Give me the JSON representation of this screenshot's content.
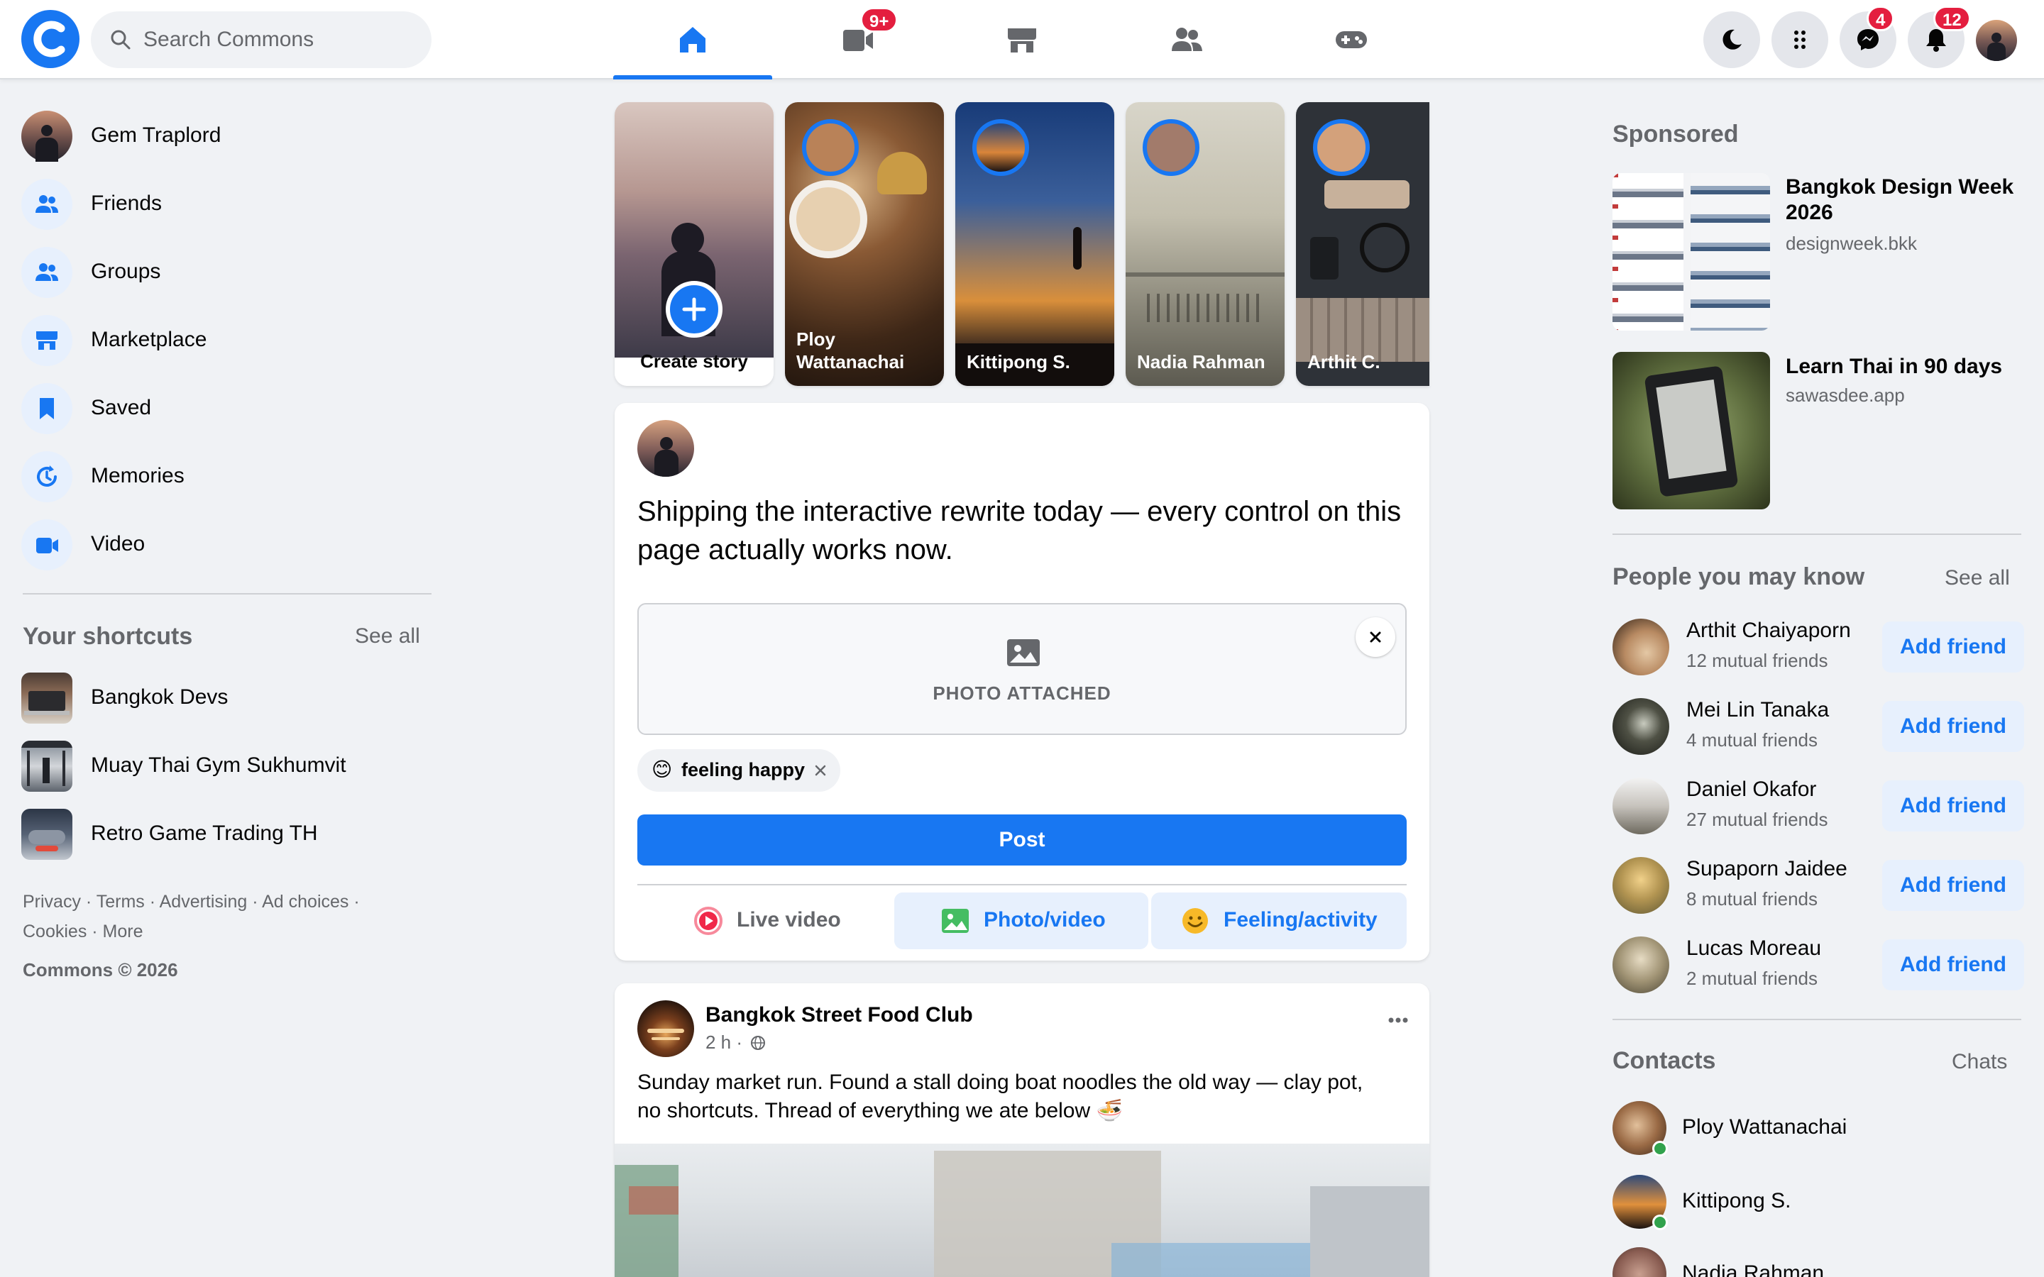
{
  "brand": {
    "logo_letter": "C",
    "accent": "#1877f2",
    "badge_color": "#e41e3f",
    "online_color": "#31a24c"
  },
  "search": {
    "placeholder": "Search Commons"
  },
  "nav": {
    "tabs": [
      {
        "name": "home-icon",
        "active": true
      },
      {
        "name": "video-icon",
        "badge": "9+"
      },
      {
        "name": "marketplace-icon"
      },
      {
        "name": "groups-icon"
      },
      {
        "name": "gaming-icon"
      }
    ]
  },
  "header_actions": {
    "dark_mode": "moon-icon",
    "menu": "grid-menu-icon",
    "messages_badge": "4",
    "notifications_badge": "12"
  },
  "sidebar": {
    "items": [
      {
        "label": "Gem Traplord",
        "icon": "profile-avatar"
      },
      {
        "label": "Friends",
        "icon": "friends-icon"
      },
      {
        "label": "Groups",
        "icon": "groups-icon"
      },
      {
        "label": "Marketplace",
        "icon": "marketplace-icon"
      },
      {
        "label": "Saved",
        "icon": "bookmark-icon"
      },
      {
        "label": "Memories",
        "icon": "memories-icon"
      },
      {
        "label": "Video",
        "icon": "video-icon"
      }
    ],
    "shortcuts_title": "Your shortcuts",
    "shortcuts_see_all": "See all",
    "shortcuts": [
      {
        "label": "Bangkok Devs"
      },
      {
        "label": "Muay Thai Gym Sukhumvit"
      },
      {
        "label": "Retro Game Trading TH"
      }
    ],
    "footer": {
      "line1": "Privacy · Terms · Advertising · Ad choices ·",
      "line2": "Cookies · More",
      "copyright": "Commons © 2026"
    }
  },
  "stories": {
    "create_label": "Create story",
    "items": [
      {
        "name": "Ploy Wattanachai"
      },
      {
        "name": "Kittipong S."
      },
      {
        "name": "Nadia Rahman"
      },
      {
        "name": "Arthit C."
      }
    ]
  },
  "composer": {
    "text": "Shipping the interactive rewrite today — every control on this page actually works now.",
    "photo_attached": "PHOTO ATTACHED",
    "feeling": "feeling happy",
    "feeling_emoji": "😊",
    "post_button": "Post",
    "actions": [
      {
        "label": "Live video"
      },
      {
        "label": "Photo/video"
      },
      {
        "label": "Feeling/activity"
      }
    ]
  },
  "feed": {
    "post": {
      "author": "Bangkok Street Food Club",
      "time": "2 h ·",
      "text_line1": "Sunday market run. Found a stall doing boat noodles the old way — clay pot,",
      "text_line2": "no shortcuts. Thread of everything we ate below 🍜"
    }
  },
  "sponsored": {
    "title": "Sponsored",
    "ads": [
      {
        "title": "Bangkok Design Week 2026",
        "title_line1": "Bangkok Design Week",
        "title_line2": "2026",
        "domain": "designweek.bkk"
      },
      {
        "title": "Learn Thai in 90 days",
        "domain": "sawasdee.app"
      }
    ]
  },
  "people": {
    "title": "People you may know",
    "see_all": "See all",
    "add_label": "Add friend",
    "items": [
      {
        "name": "Arthit Chaiyaporn",
        "mutual": "12 mutual friends"
      },
      {
        "name": "Mei Lin Tanaka",
        "mutual": "4 mutual friends"
      },
      {
        "name": "Daniel Okafor",
        "mutual": "27 mutual friends"
      },
      {
        "name": "Supaporn Jaidee",
        "mutual": "8 mutual friends"
      },
      {
        "name": "Lucas Moreau",
        "mutual": "2 mutual friends"
      }
    ]
  },
  "contacts": {
    "title": "Contacts",
    "chats": "Chats",
    "items": [
      {
        "name": "Ploy Wattanachai",
        "online": true
      },
      {
        "name": "Kittipong S.",
        "online": true
      },
      {
        "name": "Nadia Rahman",
        "online": false
      }
    ]
  }
}
